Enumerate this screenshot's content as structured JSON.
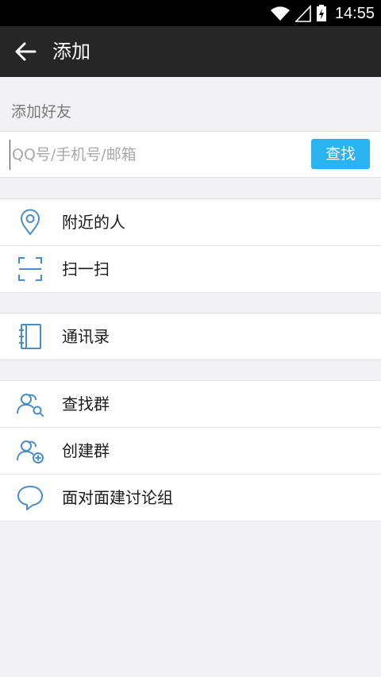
{
  "status_bar": {
    "time": "14:55"
  },
  "app_bar": {
    "title": "添加"
  },
  "add_friend": {
    "section_label": "添加好友",
    "search_placeholder": "QQ号/手机号/邮箱",
    "search_value": "",
    "find_button": "查找"
  },
  "groups": [
    {
      "items": [
        {
          "label": "附近的人",
          "icon": "location-pin-icon"
        },
        {
          "label": "扫一扫",
          "icon": "scan-icon"
        }
      ]
    },
    {
      "items": [
        {
          "label": "通讯录",
          "icon": "contacts-book-icon"
        }
      ]
    },
    {
      "items": [
        {
          "label": "查找群",
          "icon": "group-search-icon"
        },
        {
          "label": "创建群",
          "icon": "group-add-icon"
        },
        {
          "label": "面对面建讨论组",
          "icon": "chat-bubble-icon"
        }
      ]
    }
  ],
  "colors": {
    "accent": "#29b4f0",
    "icon_blue": "#4a8cc8",
    "app_bar": "#262626",
    "background": "#f2f2f4"
  }
}
